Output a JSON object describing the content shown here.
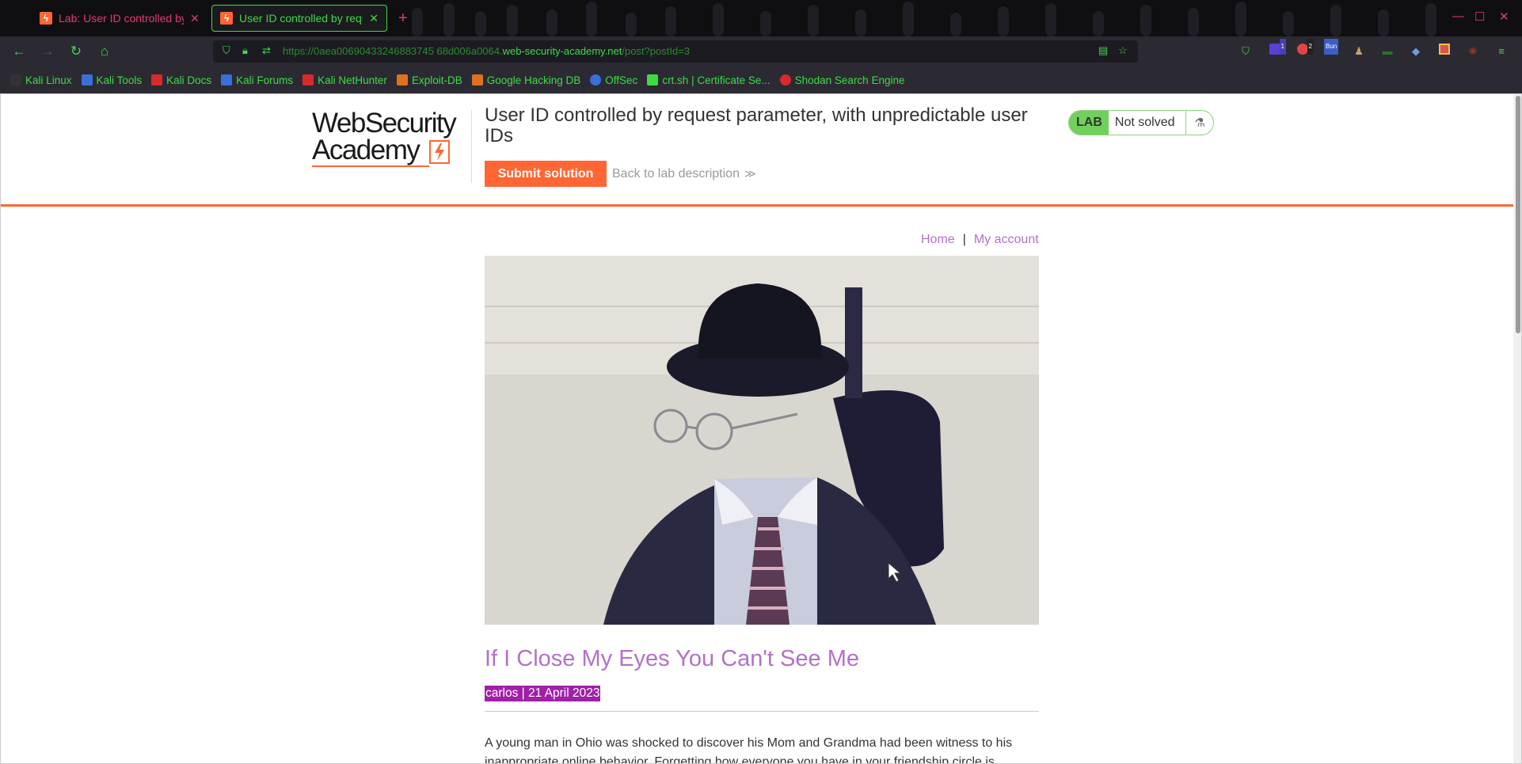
{
  "browser": {
    "tabs": [
      {
        "label": "Lab: User ID controlled by r",
        "active": false
      },
      {
        "label": "User ID controlled by reque",
        "active": true
      }
    ],
    "new_tab_symbol": "+",
    "url_prefix": "https://0aea00690433246883745 68d006a0064.",
    "url_host": "web-security-academy.net",
    "url_path": "/post?postId=3",
    "bookmarks": [
      {
        "label": "Kali Linux",
        "icon": "kali-icon",
        "color": "#222222"
      },
      {
        "label": "Kali Tools",
        "icon": "kali-tools-icon",
        "color": "#3a6fd8"
      },
      {
        "label": "Kali Docs",
        "icon": "kali-docs-icon",
        "color": "#d82a2a"
      },
      {
        "label": "Kali Forums",
        "icon": "kali-forums-icon",
        "color": "#3a6fd8"
      },
      {
        "label": "Kali NetHunter",
        "icon": "nethunter-icon",
        "color": "#d82a2a"
      },
      {
        "label": "Exploit-DB",
        "icon": "exploit-db-icon",
        "color": "#e07020"
      },
      {
        "label": "Google Hacking DB",
        "icon": "ghdb-icon",
        "color": "#e07020"
      },
      {
        "label": "OffSec",
        "icon": "offsec-icon",
        "color": "#3a6fd8"
      },
      {
        "label": "crt.sh | Certificate Se...",
        "icon": "crtsh-icon",
        "color": "#3ddc45"
      },
      {
        "label": "Shodan Search Engine",
        "icon": "shodan-icon",
        "color": "#d82a2a"
      }
    ],
    "extension_badges": [
      "1",
      "2",
      "Bun"
    ]
  },
  "lab": {
    "logo_line1": "WebSecurity",
    "logo_line2": "Academy",
    "title": "User ID controlled by request parameter, with unpredictable user IDs",
    "submit_label": "Submit solution",
    "back_label": "Back to lab description",
    "badge": "LAB",
    "status": "Not solved"
  },
  "nav": {
    "home": "Home",
    "separator": "|",
    "account": "My account"
  },
  "post": {
    "title": "If I Close My Eyes You Can't See Me",
    "meta": "carlos | 21 April 2023",
    "body": "A young man in Ohio was shocked to discover his Mom and Grandma had been witness to his inappropriate online behavior. Forgetting how everyone you have in your friendship circle is"
  },
  "colors": {
    "accent": "#ff6633",
    "link": "#b272c8",
    "kali_green": "#3ddc45",
    "kali_pink": "#e8386e",
    "meta_highlight": "#a020a8"
  }
}
